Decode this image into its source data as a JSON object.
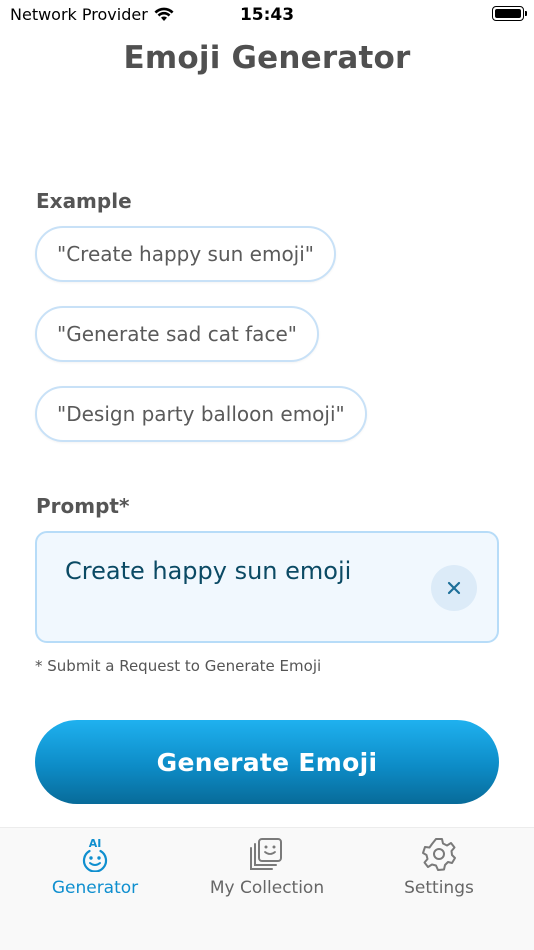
{
  "status_bar": {
    "carrier": "Network Provider",
    "time": "15:43"
  },
  "header": {
    "title": "Emoji Generator"
  },
  "examples": {
    "label": "Example",
    "items": [
      "\"Create happy sun emoji\"",
      "\"Generate sad cat face\"",
      "\"Design party balloon emoji\""
    ]
  },
  "prompt": {
    "label": "Prompt*",
    "value": "Create happy sun emoji",
    "hint": "* Submit a Request to Generate Emoji"
  },
  "actions": {
    "generate_label": "Generate Emoji"
  },
  "tabs": [
    {
      "label": "Generator",
      "icon": "ai-smiley-icon",
      "icon_text": "AI",
      "active": true
    },
    {
      "label": "My Collection",
      "icon": "collection-icon",
      "active": false
    },
    {
      "label": "Settings",
      "icon": "gear-icon",
      "active": false
    }
  ],
  "colors": {
    "accent": "#0f8fcf",
    "chip_border": "#c8e1f7",
    "prompt_bg": "#f1f8fe",
    "prompt_text": "#0b4a64",
    "button_top": "#1fb1ef",
    "button_bottom": "#086b99"
  }
}
